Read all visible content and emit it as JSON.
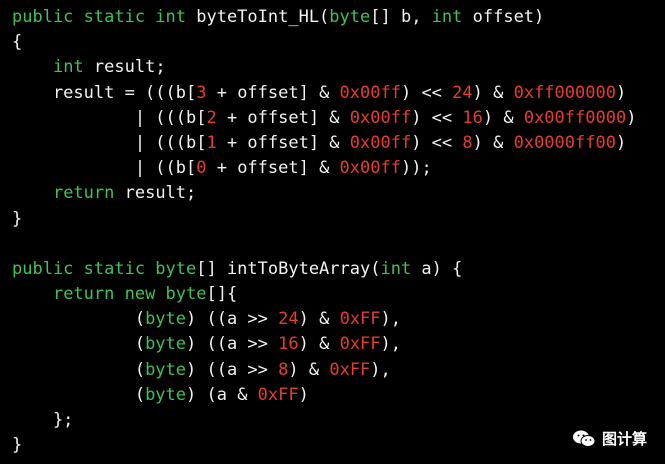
{
  "colors": {
    "background": "#000000",
    "plain": "#f2f2f2",
    "keyword": "#3fc25a",
    "number": "#e53d2f"
  },
  "code_lines": [
    [
      [
        "kw",
        "public static int"
      ],
      [
        "plain",
        " byteToInt_HL("
      ],
      [
        "kw",
        "byte"
      ],
      [
        "plain",
        "[] b, "
      ],
      [
        "kw",
        "int"
      ],
      [
        "plain",
        " offset)"
      ]
    ],
    [
      [
        "plain",
        "{"
      ]
    ],
    [
      [
        "plain",
        "    "
      ],
      [
        "kw",
        "int"
      ],
      [
        "plain",
        " result;"
      ]
    ],
    [
      [
        "plain",
        "    result = (((b["
      ],
      [
        "num",
        "3"
      ],
      [
        "plain",
        " + offset] & "
      ],
      [
        "num",
        "0x00ff"
      ],
      [
        "plain",
        ") << "
      ],
      [
        "num",
        "24"
      ],
      [
        "plain",
        ") & "
      ],
      [
        "num",
        "0xff000000"
      ],
      [
        "plain",
        ")"
      ]
    ],
    [
      [
        "plain",
        "            | (((b["
      ],
      [
        "num",
        "2"
      ],
      [
        "plain",
        " + offset] & "
      ],
      [
        "num",
        "0x00ff"
      ],
      [
        "plain",
        ") << "
      ],
      [
        "num",
        "16"
      ],
      [
        "plain",
        ") & "
      ],
      [
        "num",
        "0x00ff0000"
      ],
      [
        "plain",
        ")"
      ]
    ],
    [
      [
        "plain",
        "            | (((b["
      ],
      [
        "num",
        "1"
      ],
      [
        "plain",
        " + offset] & "
      ],
      [
        "num",
        "0x00ff"
      ],
      [
        "plain",
        ") << "
      ],
      [
        "num",
        "8"
      ],
      [
        "plain",
        ") & "
      ],
      [
        "num",
        "0x0000ff00"
      ],
      [
        "plain",
        ")"
      ]
    ],
    [
      [
        "plain",
        "            | ((b["
      ],
      [
        "num",
        "0"
      ],
      [
        "plain",
        " + offset] & "
      ],
      [
        "num",
        "0x00ff"
      ],
      [
        "plain",
        "));"
      ]
    ],
    [
      [
        "plain",
        "    "
      ],
      [
        "kw",
        "return"
      ],
      [
        "plain",
        " result;"
      ]
    ],
    [
      [
        "plain",
        "}"
      ]
    ],
    [
      [
        "plain",
        ""
      ]
    ],
    [
      [
        "kw",
        "public static byte"
      ],
      [
        "plain",
        "[] intToByteArray("
      ],
      [
        "kw",
        "int"
      ],
      [
        "plain",
        " a) {"
      ]
    ],
    [
      [
        "plain",
        "    "
      ],
      [
        "kw",
        "return new byte"
      ],
      [
        "plain",
        "[]{"
      ]
    ],
    [
      [
        "plain",
        "            ("
      ],
      [
        "kw",
        "byte"
      ],
      [
        "plain",
        ") ((a >> "
      ],
      [
        "num",
        "24"
      ],
      [
        "plain",
        ") & "
      ],
      [
        "num",
        "0xFF"
      ],
      [
        "plain",
        "),"
      ]
    ],
    [
      [
        "plain",
        "            ("
      ],
      [
        "kw",
        "byte"
      ],
      [
        "plain",
        ") ((a >> "
      ],
      [
        "num",
        "16"
      ],
      [
        "plain",
        ") & "
      ],
      [
        "num",
        "0xFF"
      ],
      [
        "plain",
        "),"
      ]
    ],
    [
      [
        "plain",
        "            ("
      ],
      [
        "kw",
        "byte"
      ],
      [
        "plain",
        ") ((a >> "
      ],
      [
        "num",
        "8"
      ],
      [
        "plain",
        ") & "
      ],
      [
        "num",
        "0xFF"
      ],
      [
        "plain",
        "),"
      ]
    ],
    [
      [
        "plain",
        "            ("
      ],
      [
        "kw",
        "byte"
      ],
      [
        "plain",
        ") (a & "
      ],
      [
        "num",
        "0xFF"
      ],
      [
        "plain",
        ")"
      ]
    ],
    [
      [
        "plain",
        "    };"
      ]
    ],
    [
      [
        "plain",
        "}"
      ]
    ]
  ],
  "watermark": {
    "icon": "wechat-icon",
    "text": "图计算"
  }
}
